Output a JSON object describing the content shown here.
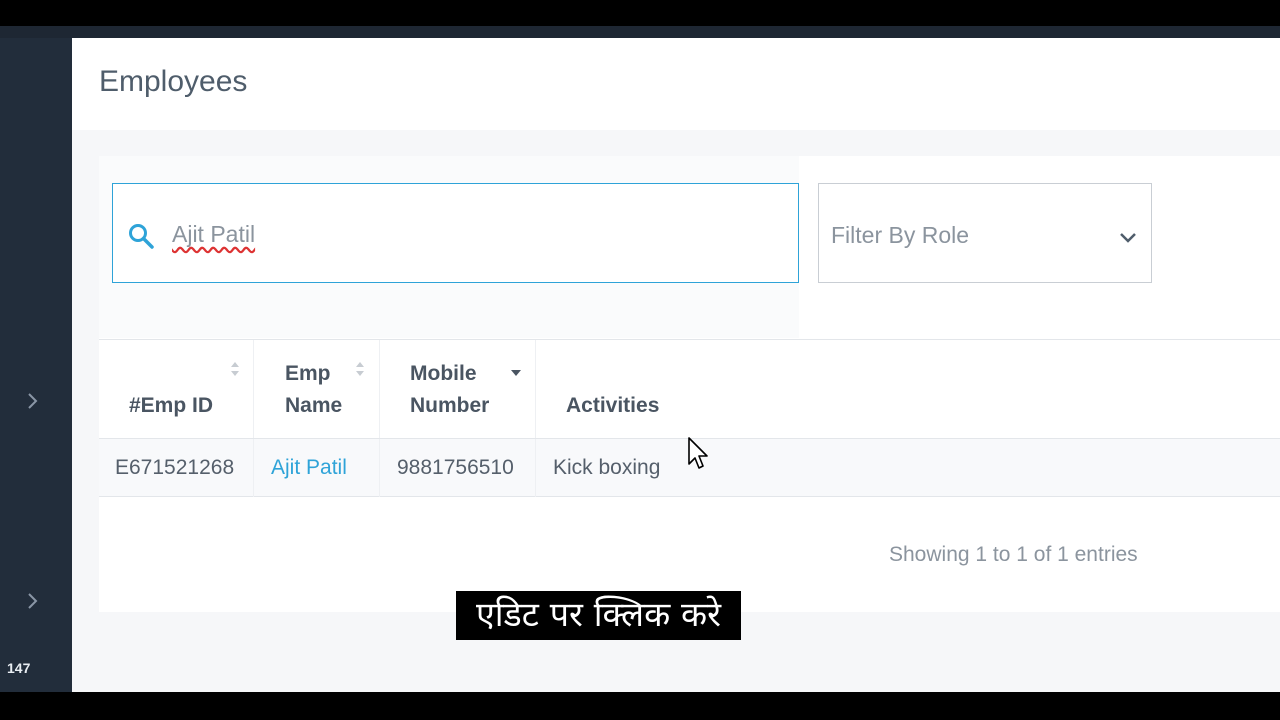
{
  "sidebar": {
    "count_badge": "147"
  },
  "page": {
    "title": "Employees"
  },
  "search": {
    "value": "Ajit Patil",
    "icon": "search-icon"
  },
  "filter": {
    "label": "Filter By Role",
    "icon": "chevron-down-icon"
  },
  "table": {
    "columns": [
      {
        "label_line1": "",
        "label_line2": "#Emp ID",
        "sort": "sortable"
      },
      {
        "label_line1": "Emp",
        "label_line2": "Name",
        "sort": "sortable"
      },
      {
        "label_line1": "Mobile",
        "label_line2": "Number",
        "sort": "descending"
      },
      {
        "label_line1": "",
        "label_line2": "Activities",
        "sort": "none"
      }
    ],
    "rows": [
      {
        "emp_id": "E671521268",
        "emp_name": "Ajit Patil",
        "mobile": "9881756510",
        "activities": "Kick boxing"
      }
    ],
    "entries_info": "Showing 1 to 1 of 1 entries"
  },
  "caption": {
    "text": "एडिट पर क्लिक करे"
  },
  "colors": {
    "accent": "#2ea3d8",
    "sidebar": "#222d3b",
    "text": "#4f5d6b"
  }
}
